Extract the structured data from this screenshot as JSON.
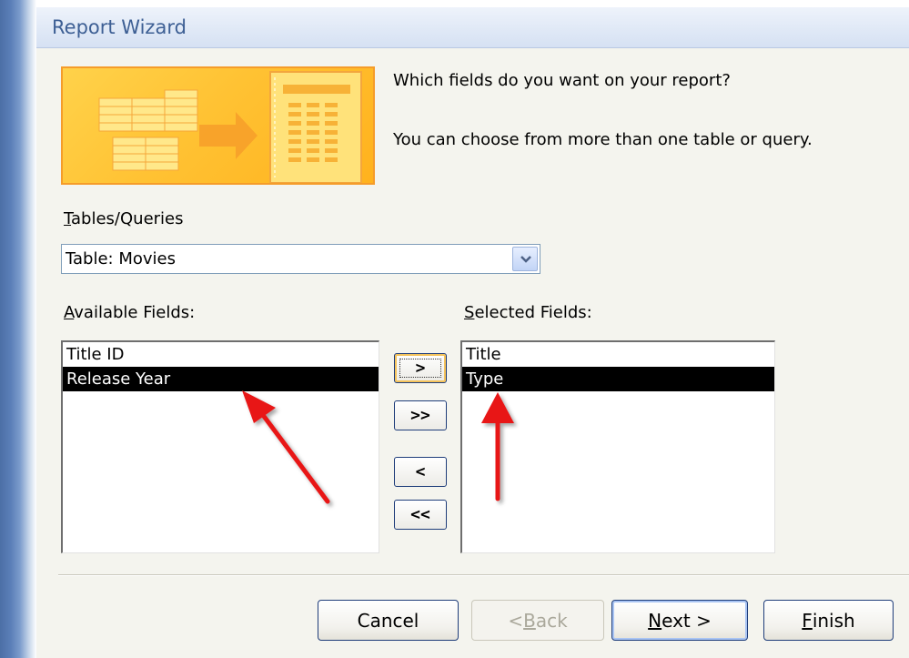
{
  "window": {
    "title": "Report Wizard"
  },
  "prompt": {
    "question": "Which fields do you want on your report?",
    "hint": "You can choose from more than one table or query."
  },
  "tables_queries": {
    "label_access": "T",
    "label_rest": "ables/Queries",
    "value": "Table: Movies"
  },
  "available_fields": {
    "label_access": "A",
    "label_rest": "vailable Fields:",
    "items": [
      "Title ID",
      "Release Year"
    ],
    "selected_index": 1
  },
  "selected_fields": {
    "label_access": "S",
    "label_rest": "elected Fields:",
    "items": [
      "Title",
      "Type"
    ],
    "selected_index": 1
  },
  "move_buttons": {
    "add_one": ">",
    "add_all": ">>",
    "remove_one": "<",
    "remove_all": "<<"
  },
  "footer": {
    "cancel": "Cancel",
    "back_pre": "< ",
    "back_access": "B",
    "back_rest": "ack",
    "next_access": "N",
    "next_rest": "ext >",
    "finish_access": "F",
    "finish_rest": "inish"
  },
  "annotation": {
    "arrow_color": "#e81414"
  },
  "colors": {
    "title_text": "#3d5f94",
    "graphic_orange": "#ffc233",
    "selection": "#000000"
  }
}
